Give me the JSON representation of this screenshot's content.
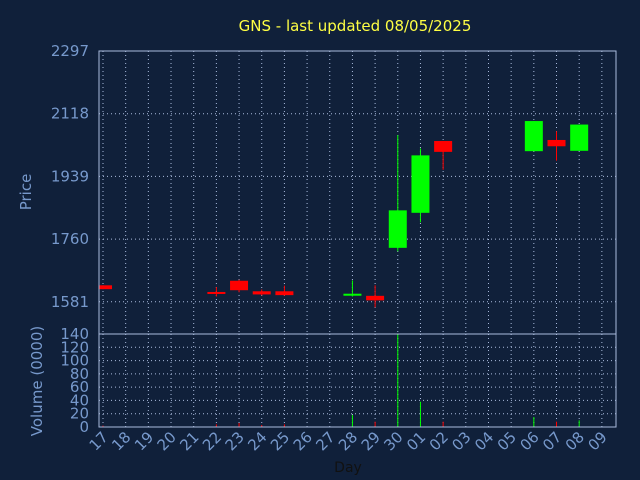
{
  "colors": {
    "background": "#10203a",
    "frame": "#aabbdd",
    "grid": "#aabbdd",
    "title": "#ffff44",
    "axis_text": "#7799cc",
    "xlabel": "#111111",
    "up": "#00ff00",
    "down": "#ff0000"
  },
  "chart_data": {
    "type": "candlestick",
    "title": "GNS - last updated 08/05/2025",
    "xlabel": "Day",
    "price_panel": {
      "ylabel": "Price",
      "ylim": [
        1489,
        2297
      ],
      "yticks": [
        1581,
        1760,
        1939,
        2118,
        2297
      ]
    },
    "volume_panel": {
      "ylabel": "Volume (0000)",
      "ylim": [
        0,
        140
      ],
      "yticks": [
        0,
        20,
        40,
        60,
        80,
        100,
        120,
        140
      ]
    },
    "x_tick_labels": [
      "17",
      "18",
      "19",
      "20",
      "21",
      "22",
      "23",
      "24",
      "25",
      "26",
      "27",
      "28",
      "29",
      "30",
      "01",
      "02",
      "03",
      "04",
      "05",
      "06",
      "07",
      "08",
      "09"
    ],
    "candles": [
      {
        "day": "17",
        "open": 1628,
        "high": 1628,
        "low": 1617,
        "close": 1617,
        "volume": 2
      },
      {
        "day": "22",
        "open": 1609,
        "high": 1623,
        "low": 1596,
        "close": 1607,
        "volume": 4
      },
      {
        "day": "23",
        "open": 1641,
        "high": 1644,
        "low": 1608,
        "close": 1614,
        "volume": 6
      },
      {
        "day": "24",
        "open": 1611,
        "high": 1616,
        "low": 1599,
        "close": 1602,
        "volume": 3
      },
      {
        "day": "25",
        "open": 1611,
        "high": 1627,
        "low": 1598,
        "close": 1600,
        "volume": 4
      },
      {
        "day": "28",
        "open": 1600,
        "high": 1642,
        "low": 1596,
        "close": 1604,
        "volume": 18
      },
      {
        "day": "29",
        "open": 1598,
        "high": 1628,
        "low": 1565,
        "close": 1585,
        "volume": 8
      },
      {
        "day": "30",
        "open": 1735,
        "high": 2057,
        "low": 1725,
        "close": 1842,
        "volume": 140
      },
      {
        "day": "01",
        "open": 1835,
        "high": 2019,
        "low": 1808,
        "close": 1999,
        "volume": 38
      },
      {
        "day": "02",
        "open": 2040,
        "high": 2040,
        "low": 1958,
        "close": 2009,
        "volume": 8
      },
      {
        "day": "06",
        "open": 2011,
        "high": 2097,
        "low": 2011,
        "close": 2097,
        "volume": 15
      },
      {
        "day": "07",
        "open": 2043,
        "high": 2068,
        "low": 1984,
        "close": 2025,
        "volume": 8
      },
      {
        "day": "08",
        "open": 2012,
        "high": 2087,
        "low": 2012,
        "close": 2087,
        "volume": 10
      }
    ]
  }
}
